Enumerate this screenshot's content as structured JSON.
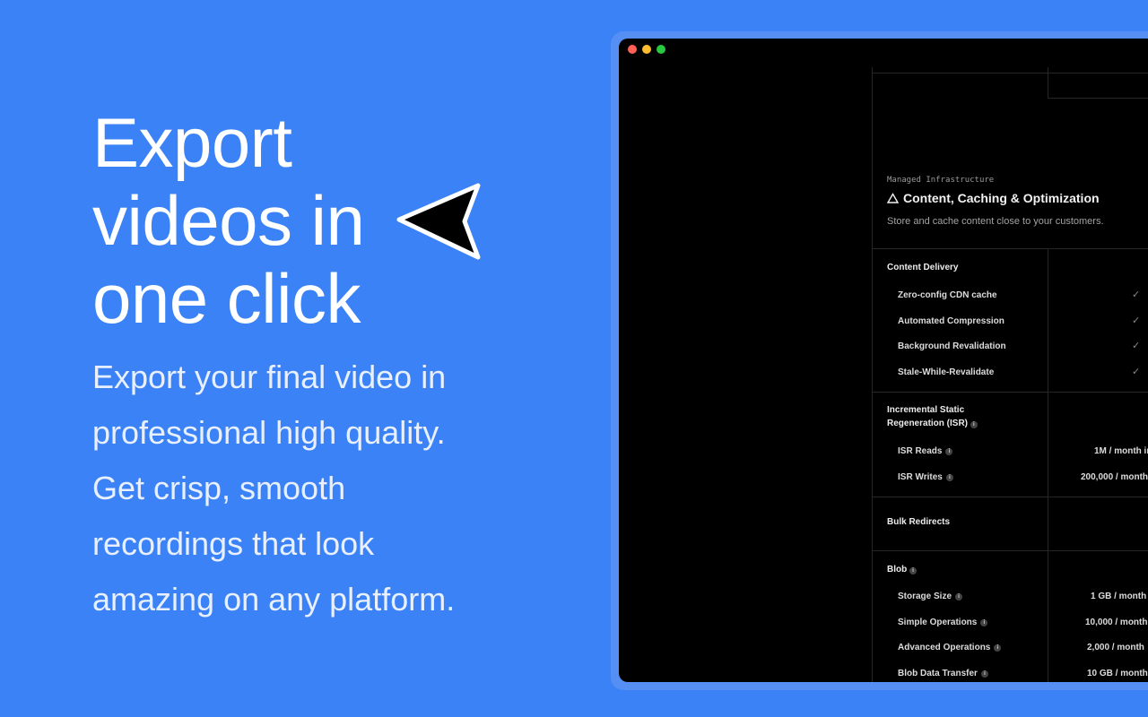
{
  "hero": {
    "title_lines": [
      "Export",
      "videos in",
      "one click"
    ],
    "subtitle": "Export your final video in professional high quality. Get crisp, smooth recordings that look amazing on any platform."
  },
  "icons": {
    "cursor": "pointer-arrow-icon",
    "section": "triangle-icon",
    "check": "check-icon",
    "info": "info-icon"
  },
  "colors": {
    "background": "#3b82f6",
    "window": "#000000",
    "traffic_red": "#ff5f57",
    "traffic_yellow": "#febc2e",
    "traffic_green": "#28c840"
  },
  "window": {
    "section_kicker": "Managed Infrastructure",
    "section_title": "Content, Caching & Optimization",
    "section_description": "Store and cache content close to your customers.",
    "groups": {
      "content_delivery": {
        "title": "Content Delivery",
        "rows": [
          {
            "label": "Zero-config CDN cache"
          },
          {
            "label": "Automated Compression"
          },
          {
            "label": "Background Revalidation"
          },
          {
            "label": "Stale-While-Revalidate"
          }
        ]
      },
      "isr": {
        "title_line1": "Incremental Static",
        "title_line2": "Regeneration (ISR)",
        "rows": [
          {
            "label": "ISR Reads",
            "value": "1M / month in"
          },
          {
            "label": "ISR Writes",
            "value": "200,000 / month"
          }
        ]
      },
      "bulk_redirects": {
        "title": "Bulk Redirects"
      },
      "blob": {
        "title": "Blob",
        "rows": [
          {
            "label": "Storage Size",
            "value": "1 GB / month"
          },
          {
            "label": "Simple Operations",
            "value": "10,000 / month"
          },
          {
            "label": "Advanced Operations",
            "value": "2,000 / month"
          },
          {
            "label": "Blob Data Transfer",
            "value": "10 GB / month"
          }
        ]
      }
    }
  }
}
